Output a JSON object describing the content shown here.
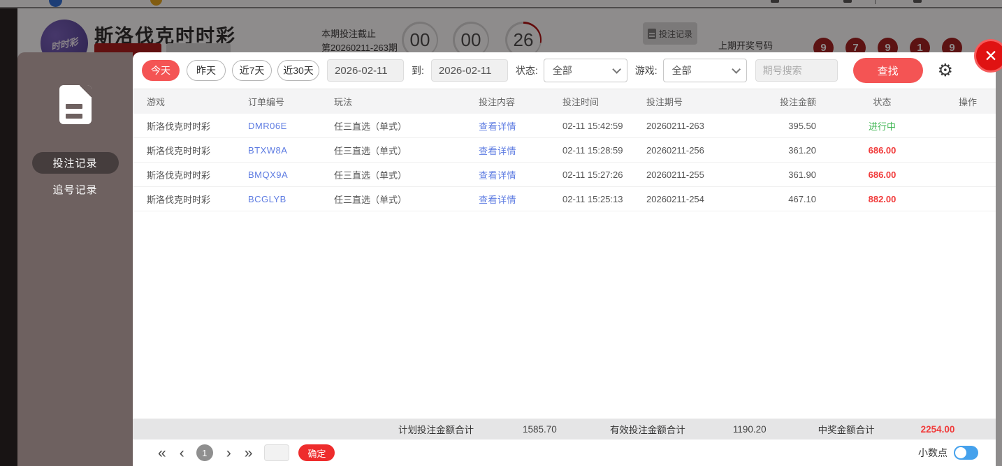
{
  "background": {
    "header": {
      "title": "斯洛伐克时时彩",
      "logo_text": "时时彩",
      "deadline_label": "本期投注截止",
      "period_label": "第20260211-263期",
      "countdown": [
        "00",
        "00",
        "26"
      ],
      "bet_record_button": "投注记录",
      "last_draw_label": "上期开奖号码",
      "last_draw_numbers": [
        "9",
        "7",
        "9",
        "1",
        "9"
      ]
    }
  },
  "modal": {
    "close_icon": "✕",
    "gear_icon": "⚙",
    "sidebar": {
      "items": [
        {
          "label": "投注记录"
        },
        {
          "label": "追号记录"
        }
      ]
    },
    "filters": {
      "quick_ranges": [
        {
          "label": "今天"
        },
        {
          "label": "昨天"
        },
        {
          "label": "近7天"
        },
        {
          "label": "近30天"
        }
      ],
      "date_from": "2026-02-11",
      "to_label": "到:",
      "date_to": "2026-02-11",
      "status_label": "状态:",
      "status_value": "全部",
      "game_label": "游戏:",
      "game_value": "全部",
      "search_placeholder": "期号搜索",
      "search_button": "查找"
    },
    "table": {
      "columns": [
        "游戏",
        "订单编号",
        "玩法",
        "投注内容",
        "投注时间",
        "投注期号",
        "投注金额",
        "状态",
        "操作"
      ],
      "rows": [
        {
          "game": "斯洛伐克时时彩",
          "order_id": "DMR06E",
          "play": "任三直选（单式）",
          "content_link": "查看详情",
          "time": "02-11 15:42:59",
          "period": "20260211-263",
          "amount": "395.50",
          "status": "进行中"
        },
        {
          "game": "斯洛伐克时时彩",
          "order_id": "BTXW8A",
          "play": "任三直选（单式）",
          "content_link": "查看详情",
          "time": "02-11 15:28:59",
          "period": "20260211-256",
          "amount": "361.20",
          "status": "686.00"
        },
        {
          "game": "斯洛伐克时时彩",
          "order_id": "BMQX9A",
          "play": "任三直选（单式）",
          "content_link": "查看详情",
          "time": "02-11 15:27:26",
          "period": "20260211-255",
          "amount": "361.90",
          "status": "686.00"
        },
        {
          "game": "斯洛伐克时时彩",
          "order_id": "BCGLYB",
          "play": "任三直选（单式）",
          "content_link": "查看详情",
          "time": "02-11 15:25:13",
          "period": "20260211-254",
          "amount": "467.10",
          "status": "882.00"
        }
      ]
    },
    "summary": {
      "plan_total_label": "计划投注金额合计",
      "plan_total": "1585.70",
      "valid_total_label": "有效投注金额合计",
      "valid_total": "1190.20",
      "win_total_label": "中奖金额合计",
      "win_total": "2254.00"
    },
    "pagination": {
      "first": "«",
      "prev": "‹",
      "current_page": "1",
      "next": "›",
      "last": "»",
      "confirm_button": "确定"
    },
    "footer_right": {
      "decimal_label": "小数点"
    }
  },
  "colors": {
    "accent_red": "#f45454",
    "deep_red": "#e01212",
    "link_blue": "#5e7ce2",
    "status_green": "#3db551",
    "amount_red": "#f13b3b",
    "toggle_blue": "#45a1ec",
    "ball_red": "#a32121",
    "sidebar_bg": "#6e6160"
  }
}
